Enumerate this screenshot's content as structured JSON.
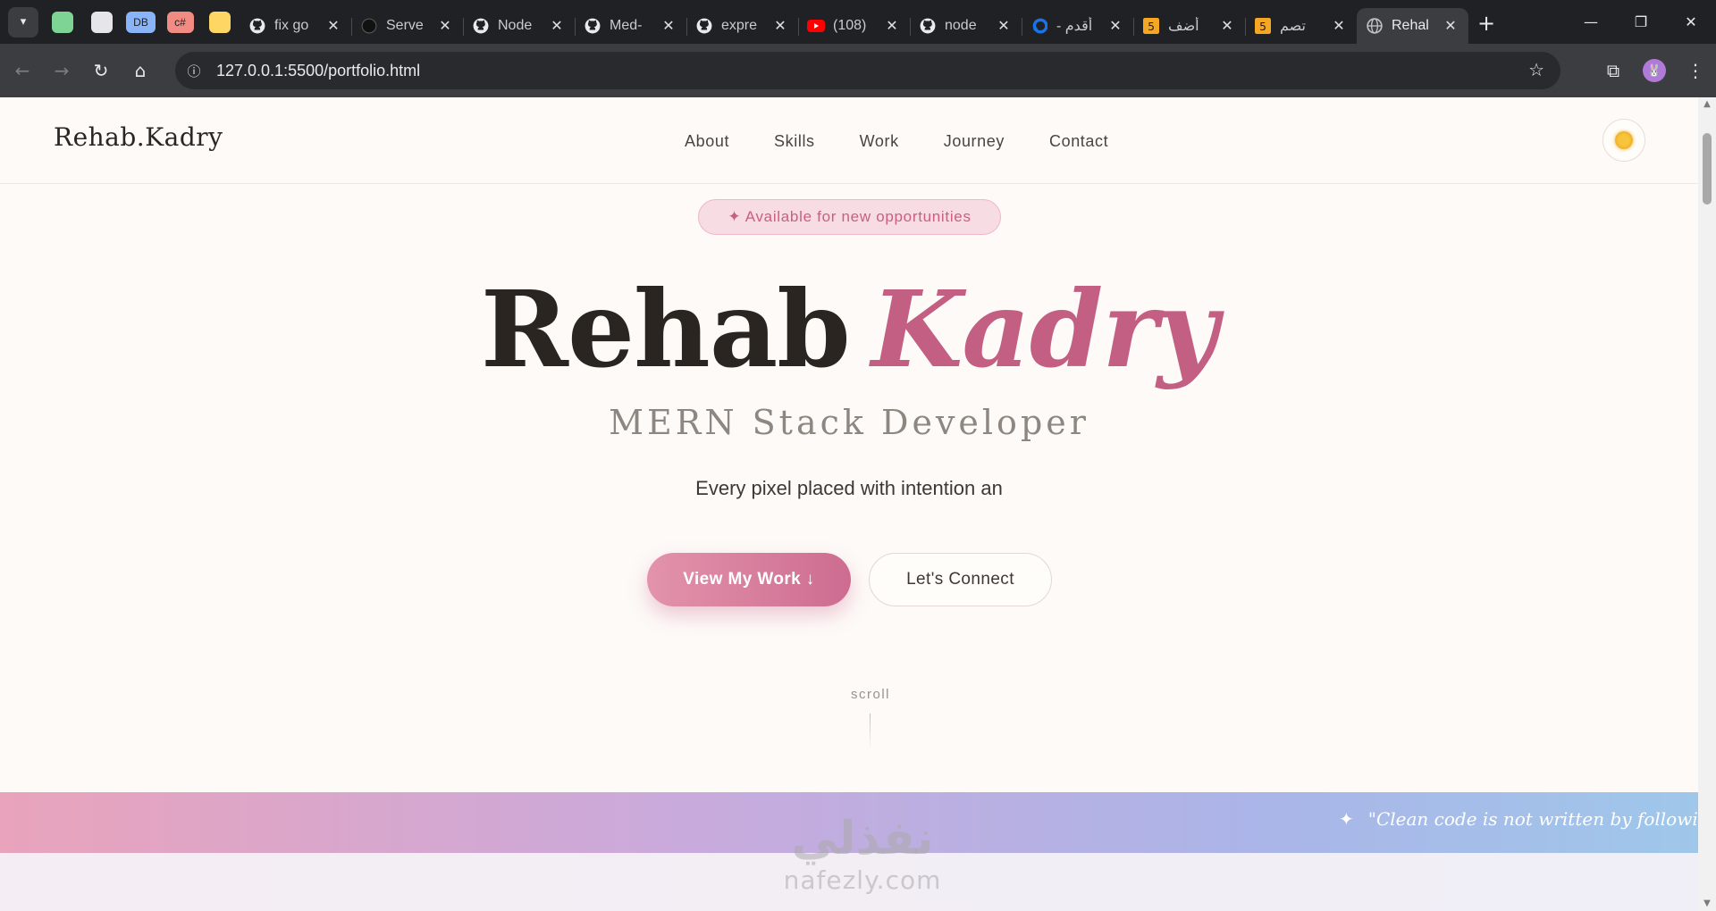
{
  "browser": {
    "pinned_tabs": [
      {
        "label": "",
        "color": "#7ed495"
      },
      {
        "label": "",
        "color": "#e6e6ea"
      },
      {
        "label": "DB",
        "color": "#8ab4f8"
      },
      {
        "label": "c#",
        "color": "#f28b82"
      },
      {
        "label": "",
        "color": "#fdd663"
      }
    ],
    "tabs": [
      {
        "title": "fix go",
        "icon": "github-icon"
      },
      {
        "title": "Serve",
        "icon": "compass-icon"
      },
      {
        "title": "Node",
        "icon": "github-icon"
      },
      {
        "title": "Med-",
        "icon": "github-icon"
      },
      {
        "title": "expre",
        "icon": "github-icon"
      },
      {
        "title": "(108)",
        "icon": "youtube-icon"
      },
      {
        "title": "node",
        "icon": "github-icon"
      },
      {
        "title": "أقدم -",
        "icon": "dart-icon"
      },
      {
        "title": "أضف",
        "icon": "html5-icon"
      },
      {
        "title": "تصم",
        "icon": "html5-icon"
      },
      {
        "title": "Rehal",
        "icon": "globe-icon",
        "active": true
      }
    ],
    "url": "127.0.0.1:5500/portfolio.html"
  },
  "site": {
    "logo": "Rehab.Kadry",
    "nav": [
      "About",
      "Skills",
      "Work",
      "Journey",
      "Contact"
    ]
  },
  "hero": {
    "badge": "✦ Available for new opportunities",
    "name_first": "Rehab",
    "name_last": "Kadry",
    "role": "MERN Stack Developer",
    "tagline": "Every pixel placed with intention an",
    "primary_cta": "View My Work ↓",
    "secondary_cta": "Let's Connect",
    "scroll_label": "scroll"
  },
  "marquee": {
    "star": "✦",
    "quote": "\"Clean code is not written by following rules. C"
  },
  "watermark": {
    "arabic": "نفذلي",
    "latin": "nafezly.com"
  },
  "colors": {
    "accent": "#c25f82",
    "badge_bg": "#f8dce3",
    "page_bg": "#fdfaf7"
  }
}
